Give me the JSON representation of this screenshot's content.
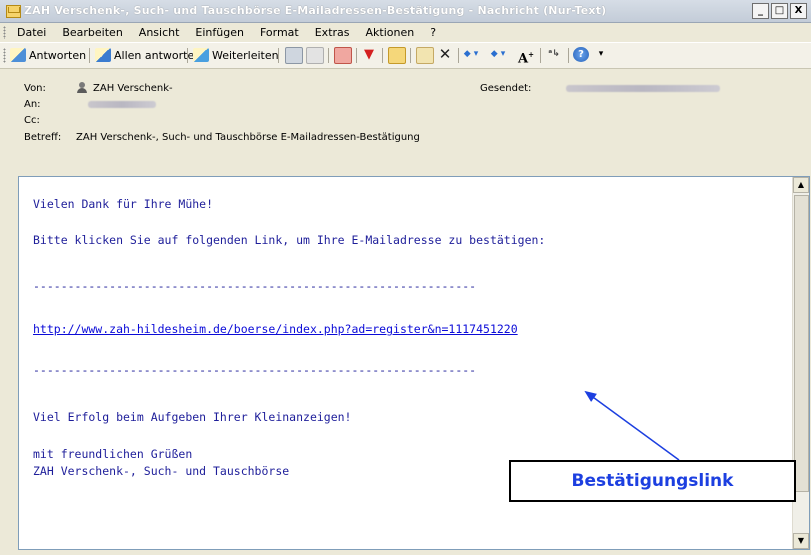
{
  "window": {
    "title": "ZAH Verschenk-, Such- und Tauschbörse E-Mailadressen-Bestätigung - Nachricht (Nur-Text)",
    "buttons": [
      "_",
      "□",
      "X"
    ]
  },
  "menu": [
    "Datei",
    "Bearbeiten",
    "Ansicht",
    "Einfügen",
    "Format",
    "Extras",
    "Aktionen",
    "?"
  ],
  "toolbar": {
    "reply_label": "Antworten",
    "reply_all_label": "Allen antworten",
    "forward_label": "Weiterleiten",
    "font_size_label": "A",
    "icons": [
      "print-icon",
      "copy-icon",
      "flag-icon",
      "folder-icon",
      "delete-icon",
      "up-icon",
      "down-icon",
      "help-icon"
    ]
  },
  "header": {
    "from_label": "Von:",
    "from_value": "ZAH Verschenk-",
    "to_label": "An:",
    "cc_label": "Cc:",
    "subject_label": "Betreff:",
    "subject_value": "ZAH Verschenk-, Such- und Tauschbörse E-Mailadressen-Bestätigung",
    "sent_label": "Gesendet:"
  },
  "body": {
    "line1": "Vielen Dank für Ihre Mühe!",
    "line2": "Bitte klicken Sie auf folgenden Link, um Ihre E-Mailadresse zu bestätigen:",
    "separator": "----------------------------------------------------------------",
    "link": "http://www.zah-hildesheim.de/boerse/index.php?ad=register&n=1117451220",
    "line3": "Viel Erfolg beim Aufgeben Ihrer Kleinanzeigen!",
    "line4": "mit freundlichen Grüßen",
    "line5": "ZAH Verschenk-, Such- und Tauschbörse"
  },
  "annotation": {
    "label": "Bestätigungslink",
    "color": "#1c3fe0"
  }
}
